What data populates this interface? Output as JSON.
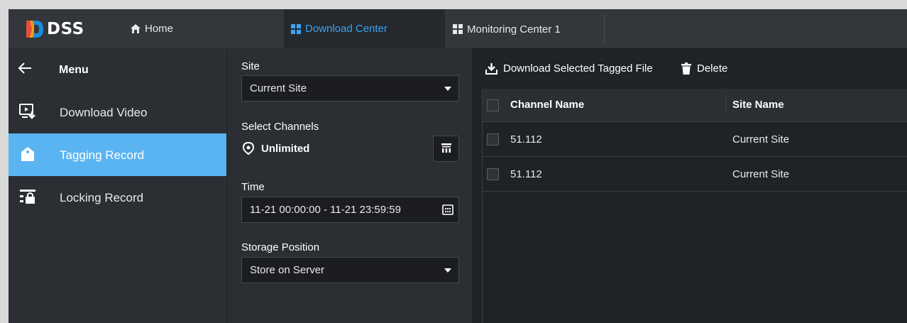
{
  "app": {
    "logo_text": "DSS"
  },
  "tabs": [
    {
      "label": "Home",
      "icon": "home-icon"
    },
    {
      "label": "Download Center",
      "icon": "grid-icon",
      "active": true
    },
    {
      "label": "Monitoring Center 1",
      "icon": "grid-icon"
    }
  ],
  "sidebar": {
    "menu_label": "Menu",
    "items": [
      {
        "label": "Download Video",
        "icon": "download-video-icon"
      },
      {
        "label": "Tagging Record",
        "icon": "tag-icon",
        "active": true
      },
      {
        "label": "Locking Record",
        "icon": "lock-record-icon"
      }
    ]
  },
  "filters": {
    "site_label": "Site",
    "site_value": "Current Site",
    "channels_label": "Select Channels",
    "channels_value": "Unlimited",
    "time_label": "Time",
    "time_value": "11-21 00:00:00 - 11-21 23:59:59",
    "storage_label": "Storage Position",
    "storage_value": "Store on Server"
  },
  "toolbar": {
    "download_label": "Download Selected Tagged File",
    "delete_label": "Delete"
  },
  "table": {
    "columns": [
      "Channel Name",
      "Site Name"
    ],
    "rows": [
      [
        "51.112",
        "Current Site"
      ],
      [
        "51.112",
        "Current Site"
      ]
    ]
  },
  "colors": {
    "accent": "#3ba4f5",
    "active_nav": "#5ab4f2",
    "background": "#1f2226",
    "panel": "#2b2e33",
    "topbar": "#33363b"
  }
}
